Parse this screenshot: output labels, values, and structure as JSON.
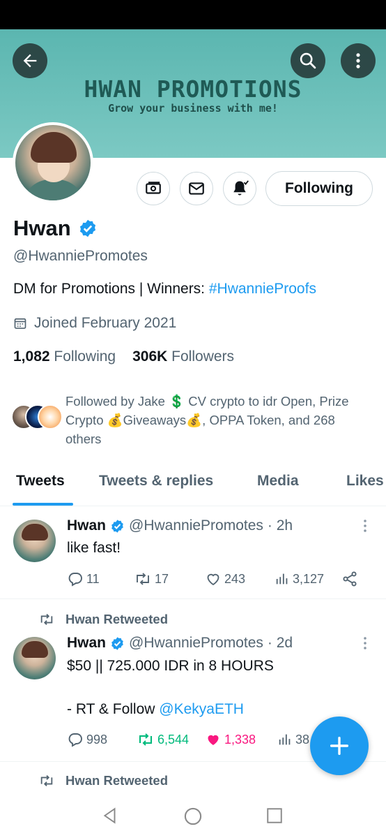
{
  "banner": {
    "title": "HWAN PROMOTIONS",
    "subtitle": "Grow your business with me!",
    "bg_color": "#6cbfb9"
  },
  "header_buttons": {
    "back_icon": "arrow-left-icon",
    "search_icon": "search-icon",
    "more_icon": "more-vertical-icon"
  },
  "profile": {
    "name": "Hwan",
    "handle": "@HwanniePromotes",
    "bio_text": "DM for Promotions | Winners: ",
    "bio_hashtag": "#HwannieProofs",
    "joined": "Joined February 2021",
    "following_count": "1,082",
    "following_label": "Following",
    "followers_count": "306K",
    "followers_label": "Followers",
    "followed_by": "Followed by Jake 💲 CV crypto to idr Open, Prize Crypto 💰Giveaways💰, OPPA Token, and 268 others",
    "follow_button_label": "Following",
    "verified_color": "#1d9bf0"
  },
  "tabs": [
    {
      "label": "Tweets",
      "active": true
    },
    {
      "label": "Tweets & replies",
      "active": false
    },
    {
      "label": "Media",
      "active": false
    },
    {
      "label": "Likes",
      "active": false
    }
  ],
  "tweets": [
    {
      "name": "Hwan",
      "handle": "@HwanniePromotes",
      "time": "· 2h",
      "text_lines": [
        "like fast!"
      ],
      "replies": "11",
      "retweets": "17",
      "likes": "243",
      "views": "3,127"
    },
    {
      "retweeted_by": "Hwan Retweeted",
      "name": "Hwan",
      "handle": "@HwanniePromotes",
      "time": "· 2d",
      "text_line1": "$50 || 725.000 IDR in 8 HOURS",
      "text_line2_prefix": "- RT & Follow ",
      "text_line2_mention": "@KekyaETH",
      "replies": "998",
      "retweets": "6,544",
      "likes": "1,338",
      "views": "38"
    },
    {
      "retweeted_by": "Hwan Retweeted"
    }
  ],
  "colors": {
    "accent": "#1d9bf0",
    "retweet_active": "#00ba7c",
    "like_active": "#f91880",
    "muted": "#536471"
  }
}
